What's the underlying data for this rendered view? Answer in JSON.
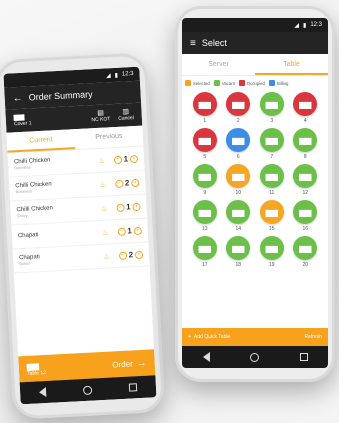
{
  "colors": {
    "selected": "#f5a623",
    "vacant": "#6cc04a",
    "occupied": "#d9363e",
    "billing": "#3a8ee6"
  },
  "phone_a": {
    "status_time": "12:3",
    "title": "Order Summary",
    "cover_label": "Cover 1",
    "nc_kot_label": "NC KOT",
    "cancel_label": "Cancel",
    "tabs": [
      "Current",
      "Previous"
    ],
    "items": [
      {
        "name": "Chilli Chicken",
        "note": "Boneless",
        "qty": "1"
      },
      {
        "name": "Chilli Chicken",
        "note": "Boneless",
        "qty": "2"
      },
      {
        "name": "Chilli Chicken",
        "note": "Gravy",
        "qty": "1"
      },
      {
        "name": "Chapati",
        "note": "",
        "qty": "1"
      },
      {
        "name": "Chapati",
        "note": "Butter",
        "qty": "2"
      }
    ],
    "table_label": "Table 12",
    "order_label": "Order"
  },
  "phone_b": {
    "status_time": "12:3",
    "title": "Select",
    "tabs": [
      "Server",
      "Table"
    ],
    "legend": [
      {
        "label": "Selected",
        "color": "#f5a623"
      },
      {
        "label": "Vacant",
        "color": "#6cc04a"
      },
      {
        "label": "Occupied",
        "color": "#d9363e"
      },
      {
        "label": "Billing",
        "color": "#3a8ee6"
      }
    ],
    "tables": [
      {
        "num": "1",
        "state": "occupied"
      },
      {
        "num": "2",
        "state": "occupied"
      },
      {
        "num": "3",
        "state": "vacant"
      },
      {
        "num": "4",
        "state": "occupied"
      },
      {
        "num": "5",
        "state": "occupied"
      },
      {
        "num": "6",
        "state": "billing"
      },
      {
        "num": "7",
        "state": "vacant"
      },
      {
        "num": "8",
        "state": "vacant"
      },
      {
        "num": "9",
        "state": "vacant"
      },
      {
        "num": "10",
        "state": "selected"
      },
      {
        "num": "11",
        "state": "vacant"
      },
      {
        "num": "12",
        "state": "vacant"
      },
      {
        "num": "13",
        "state": "vacant"
      },
      {
        "num": "14",
        "state": "vacant"
      },
      {
        "num": "15",
        "state": "selected"
      },
      {
        "num": "16",
        "state": "vacant"
      },
      {
        "num": "17",
        "state": "vacant"
      },
      {
        "num": "18",
        "state": "vacant"
      },
      {
        "num": "19",
        "state": "vacant"
      },
      {
        "num": "20",
        "state": "vacant"
      }
    ],
    "add_label": "Add Quick Table",
    "refresh_label": "Refresh"
  }
}
